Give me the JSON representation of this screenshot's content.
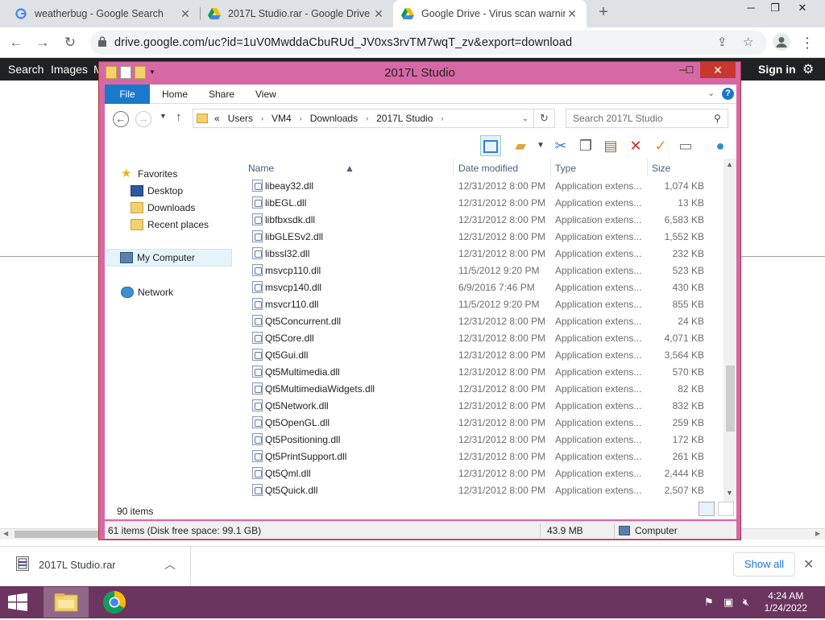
{
  "browser": {
    "tabs": [
      {
        "title": "weatherbug - Google Search",
        "icon": "google-icon"
      },
      {
        "title": "2017L Studio.rar - Google Drive",
        "icon": "drive-icon"
      },
      {
        "title": "Google Drive - Virus scan warnin",
        "icon": "drive-icon"
      }
    ],
    "new_tab": "+",
    "url": "drive.google.com/uc?id=1uV0MwddaCbuRUd_JV0xs3rvTM7wqT_zv&export=download"
  },
  "google_bar": {
    "search": "Search",
    "images": "Images",
    "more": "M",
    "sign_in": "Sign in"
  },
  "explorer": {
    "title": "2017L Studio",
    "ribbon_tabs": [
      "File",
      "Home",
      "Share",
      "View"
    ],
    "breadcrumb": [
      "«",
      "Users",
      "VM4",
      "Downloads",
      "2017L Studio"
    ],
    "search_placeholder": "Search 2017L Studio",
    "nav": {
      "favorites": "Favorites",
      "desktop": "Desktop",
      "downloads": "Downloads",
      "recent": "Recent places",
      "computer": "My Computer",
      "network": "Network"
    },
    "columns": {
      "name": "Name",
      "date": "Date modified",
      "type": "Type",
      "size": "Size"
    },
    "files": [
      {
        "name": "libeay32.dll",
        "date": "12/31/2012 8:00 PM",
        "type": "Application extens...",
        "size": "1,074 KB"
      },
      {
        "name": "libEGL.dll",
        "date": "12/31/2012 8:00 PM",
        "type": "Application extens...",
        "size": "13 KB"
      },
      {
        "name": "libfbxsdk.dll",
        "date": "12/31/2012 8:00 PM",
        "type": "Application extens...",
        "size": "6,583 KB"
      },
      {
        "name": "libGLESv2.dll",
        "date": "12/31/2012 8:00 PM",
        "type": "Application extens...",
        "size": "1,552 KB"
      },
      {
        "name": "libssl32.dll",
        "date": "12/31/2012 8:00 PM",
        "type": "Application extens...",
        "size": "232 KB"
      },
      {
        "name": "msvcp110.dll",
        "date": "11/5/2012 9:20 PM",
        "type": "Application extens...",
        "size": "523 KB"
      },
      {
        "name": "msvcp140.dll",
        "date": "6/9/2016 7:46 PM",
        "type": "Application extens...",
        "size": "430 KB"
      },
      {
        "name": "msvcr110.dll",
        "date": "11/5/2012 9:20 PM",
        "type": "Application extens...",
        "size": "855 KB"
      },
      {
        "name": "Qt5Concurrent.dll",
        "date": "12/31/2012 8:00 PM",
        "type": "Application extens...",
        "size": "24 KB"
      },
      {
        "name": "Qt5Core.dll",
        "date": "12/31/2012 8:00 PM",
        "type": "Application extens...",
        "size": "4,071 KB"
      },
      {
        "name": "Qt5Gui.dll",
        "date": "12/31/2012 8:00 PM",
        "type": "Application extens...",
        "size": "3,564 KB"
      },
      {
        "name": "Qt5Multimedia.dll",
        "date": "12/31/2012 8:00 PM",
        "type": "Application extens...",
        "size": "570 KB"
      },
      {
        "name": "Qt5MultimediaWidgets.dll",
        "date": "12/31/2012 8:00 PM",
        "type": "Application extens...",
        "size": "82 KB"
      },
      {
        "name": "Qt5Network.dll",
        "date": "12/31/2012 8:00 PM",
        "type": "Application extens...",
        "size": "832 KB"
      },
      {
        "name": "Qt5OpenGL.dll",
        "date": "12/31/2012 8:00 PM",
        "type": "Application extens...",
        "size": "259 KB"
      },
      {
        "name": "Qt5Positioning.dll",
        "date": "12/31/2012 8:00 PM",
        "type": "Application extens...",
        "size": "172 KB"
      },
      {
        "name": "Qt5PrintSupport.dll",
        "date": "12/31/2012 8:00 PM",
        "type": "Application extens...",
        "size": "261 KB"
      },
      {
        "name": "Qt5Qml.dll",
        "date": "12/31/2012 8:00 PM",
        "type": "Application extens...",
        "size": "2,444 KB"
      },
      {
        "name": "Qt5Quick.dll",
        "date": "12/31/2012 8:00 PM",
        "type": "Application extens...",
        "size": "2,507 KB"
      }
    ],
    "item_count": "90 items",
    "status": {
      "items": "61 items (Disk free space: 99.1 GB)",
      "size": "43.9 MB",
      "location": "Computer"
    }
  },
  "download_bar": {
    "filename": "2017L Studio.rar",
    "show_all": "Show all"
  },
  "taskbar": {
    "time": "4:24 AM",
    "date": "1/24/2022"
  },
  "colors": {
    "explorer_frame": "#d668a6",
    "taskbar": "#6b3560",
    "ribbon_file": "#1979ca"
  }
}
